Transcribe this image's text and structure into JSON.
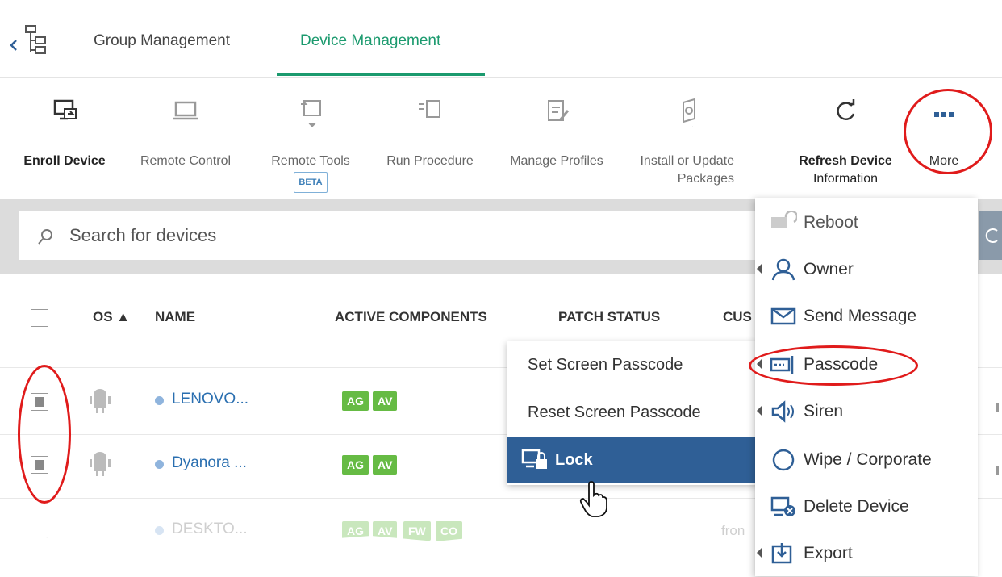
{
  "tabs": {
    "group_management": "Group Management",
    "device_management": "Device Management"
  },
  "toolbar": {
    "enroll_device": "Enroll Device",
    "remote_control": "Remote Control",
    "remote_tools": "Remote Tools",
    "remote_tools_badge": "BETA",
    "run_procedure": "Run Procedure",
    "manage_profiles": "Manage Profiles",
    "install_update_line1": "Install or Update",
    "install_update_line2": "Packages",
    "refresh_line1": "Refresh Device",
    "refresh_line2": "Information",
    "more": "More"
  },
  "search": {
    "placeholder": "Search for devices"
  },
  "table": {
    "headers": {
      "os": "OS ▲",
      "name": "NAME",
      "active_components": "ACTIVE COMPONENTS",
      "patch_status": "PATCH STATUS",
      "customer": "CUS"
    },
    "rows": [
      {
        "name": "LENOVO...",
        "badges": [
          "AG",
          "AV"
        ]
      },
      {
        "name": "Dyanora ...",
        "badges": [
          "AG",
          "AV"
        ]
      },
      {
        "name": "DESKTO...",
        "badges": [
          "AG",
          "AV",
          "FW",
          "CO"
        ],
        "extra": "fron"
      }
    ]
  },
  "passcode_submenu": {
    "set": "Set Screen Passcode",
    "reset": "Reset Screen Passcode",
    "lock": "Lock"
  },
  "more_menu": {
    "reboot": "Reboot",
    "owner": "Owner",
    "send_message": "Send Message",
    "passcode": "Passcode",
    "siren": "Siren",
    "wipe": "Wipe / Corporate",
    "delete_device": "Delete Device",
    "export": "Export"
  },
  "colors": {
    "accent": "#1b9a6e",
    "link": "#2a6fb0",
    "highlight": "#2f5f96",
    "badge_green": "#66bb44",
    "annotation_red": "#e01b1b"
  }
}
